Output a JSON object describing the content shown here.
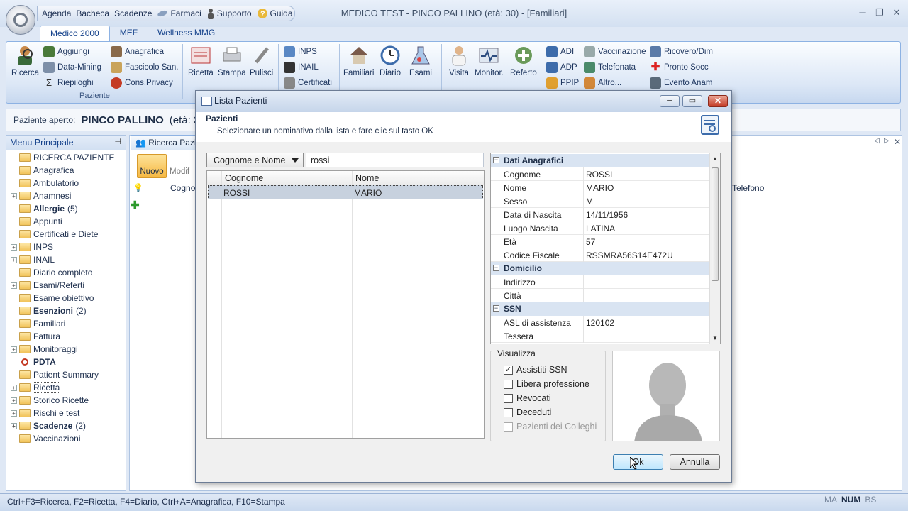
{
  "window": {
    "title": "MEDICO TEST - PINCO PALLINO (età: 30)  - [Familiari]"
  },
  "quick_access": [
    "Agenda",
    "Bacheca",
    "Scadenze",
    "Farmaci",
    "Supporto",
    "Guida"
  ],
  "ribbon": {
    "tabs": [
      "Medico 2000",
      "MEF",
      "Wellness MMG"
    ],
    "active_tab": "Medico 2000",
    "group_label": "Paziente",
    "ricerca": "Ricerca",
    "small_a": [
      "Aggiungi",
      "Data-Mining",
      "Riepiloghi"
    ],
    "small_b": [
      "Anagrafica",
      "Fascicolo San.",
      "Cons.Privacy"
    ],
    "big_b": [
      "Ricetta",
      "Stampa",
      "Pulisci"
    ],
    "small_c": [
      "INPS",
      "INAIL",
      "Certificati"
    ],
    "big_c": [
      "Familiari",
      "Diario",
      "Esami"
    ],
    "big_d": [
      "Visita",
      "Monitor.",
      "Referto"
    ],
    "small_d": [
      "ADI",
      "ADP",
      "PPIP"
    ],
    "small_e": [
      "Vaccinazione",
      "Telefonata",
      "Altro..."
    ],
    "small_f": [
      "Ricovero/Dim",
      "Pronto Socc",
      "Evento Anam"
    ]
  },
  "patient_bar": {
    "label": "Paziente aperto:",
    "name": "PINCO PALLINO",
    "age": "(età: 30)"
  },
  "menu": {
    "title": "Menu Principale",
    "items": [
      {
        "label": "RICERCA PAZIENTE",
        "expand": false,
        "bold": false
      },
      {
        "label": "Anagrafica",
        "expand": false,
        "bold": false
      },
      {
        "label": "Ambulatorio",
        "expand": false,
        "bold": false
      },
      {
        "label": "Anamnesi",
        "expand": true,
        "bold": false
      },
      {
        "label": "Allergie",
        "count": "(5)",
        "expand": false,
        "bold": true
      },
      {
        "label": "Appunti",
        "expand": false,
        "bold": false
      },
      {
        "label": "Certificati e Diete",
        "expand": false,
        "bold": false
      },
      {
        "label": "INPS",
        "expand": true,
        "bold": false
      },
      {
        "label": "INAIL",
        "expand": true,
        "bold": false
      },
      {
        "label": "Diario completo",
        "expand": false,
        "bold": false
      },
      {
        "label": "Esami/Referti",
        "expand": true,
        "bold": false
      },
      {
        "label": "Esame obiettivo",
        "expand": false,
        "bold": false
      },
      {
        "label": "Esenzioni",
        "count": "(2)",
        "expand": false,
        "bold": true
      },
      {
        "label": "Familiari",
        "expand": false,
        "bold": false
      },
      {
        "label": "Fattura",
        "expand": false,
        "bold": false
      },
      {
        "label": "Monitoraggi",
        "expand": true,
        "bold": false
      },
      {
        "label": "PDTA",
        "expand": false,
        "bold": true,
        "icon": "target-icon"
      },
      {
        "label": "Patient Summary",
        "expand": false,
        "bold": false
      },
      {
        "label": "Ricetta",
        "expand": true,
        "bold": false,
        "selected": true
      },
      {
        "label": "Storico Ricette",
        "expand": true,
        "bold": false
      },
      {
        "label": "Rischi e test",
        "expand": true,
        "bold": false
      },
      {
        "label": "Scadenze",
        "count": "(2)",
        "expand": true,
        "bold": true
      },
      {
        "label": "Vaccinazioni",
        "expand": false,
        "bold": false
      }
    ]
  },
  "main_tab": {
    "label": "Ricerca Pazi",
    "toolbar": [
      "Nuovo",
      "Modif"
    ],
    "col_cogno": "Cogno",
    "col_telefono": "Telefono"
  },
  "dialog": {
    "title": "Lista Pazienti",
    "header_title": "Pazienti",
    "header_subtitle": "Selezionare un nominativo dalla lista e fare clic sul tasto OK",
    "search_mode": "Cognome e Nome",
    "search_value": "rossi",
    "grid_headers": [
      "Cognome",
      "Nome"
    ],
    "rows": [
      {
        "cognome": "ROSSI",
        "nome": "MARIO"
      }
    ],
    "props": {
      "cat_anagrafici": "Dati Anagrafici",
      "anagrafici": [
        {
          "k": "Cognome",
          "v": "ROSSI"
        },
        {
          "k": "Nome",
          "v": "MARIO"
        },
        {
          "k": "Sesso",
          "v": "M"
        },
        {
          "k": "Data di Nascita",
          "v": "14/11/1956"
        },
        {
          "k": "Luogo Nascita",
          "v": "LATINA"
        },
        {
          "k": "Età",
          "v": "57"
        },
        {
          "k": "Codice Fiscale",
          "v": "RSSMRA56S14E472U"
        }
      ],
      "cat_domicilio": "Domicilio",
      "domicilio": [
        {
          "k": "Indirizzo",
          "v": ""
        },
        {
          "k": "Città",
          "v": ""
        }
      ],
      "cat_ssn": "SSN",
      "ssn": [
        {
          "k": "ASL di assistenza",
          "v": "120102"
        },
        {
          "k": "Tessera",
          "v": ""
        }
      ]
    },
    "visualizza": {
      "label": "Visualizza",
      "options": [
        {
          "label": "Assistiti SSN",
          "checked": true,
          "disabled": false
        },
        {
          "label": "Libera professione",
          "checked": false,
          "disabled": false
        },
        {
          "label": "Revocati",
          "checked": false,
          "disabled": false
        },
        {
          "label": "Deceduti",
          "checked": false,
          "disabled": false
        },
        {
          "label": "Pazienti dei Colleghi",
          "checked": false,
          "disabled": true
        }
      ]
    },
    "ok_label": "Ok",
    "cancel_label": "Annulla"
  },
  "status_bar": {
    "text": "Ctrl+F3=Ricerca, F2=Ricetta, F4=Diario, Ctrl+A=Anagrafica, F10=Stampa",
    "indicators": [
      "MA",
      "NUM",
      "BS"
    ]
  },
  "colors": {
    "ribbon_text": "#15428b",
    "selection": "#c7d1de",
    "accent": "#8db2e3"
  }
}
